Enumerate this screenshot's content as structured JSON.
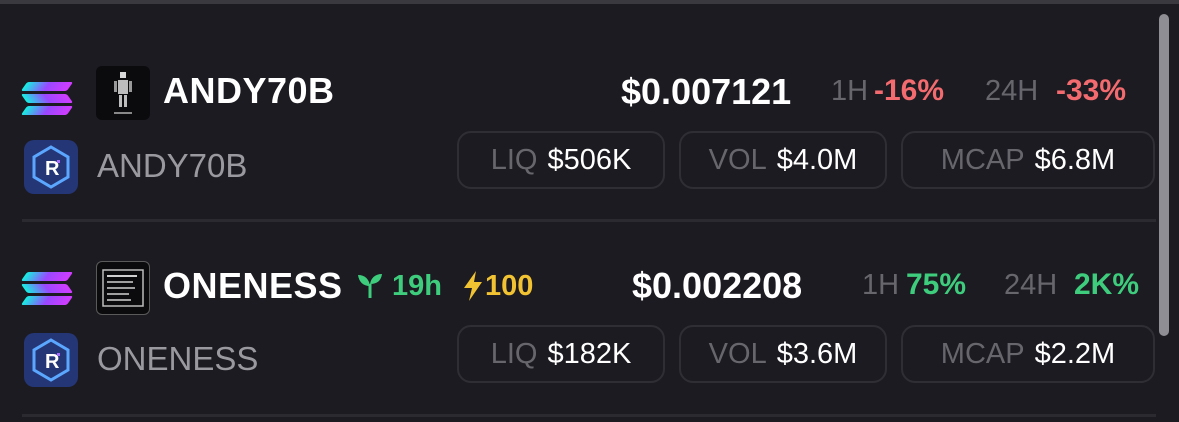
{
  "tokens": [
    {
      "chain_icon": "solana-icon",
      "avatar_icon": "pixel-figure-icon",
      "dex_icon": "raydium-icon",
      "name": "ANDY70B",
      "sub_name": "ANDY70B",
      "price": "$0.007121",
      "h1_label": "1H",
      "h1_change": "-16%",
      "h24_label": "24H",
      "h24_change": "-33%",
      "change_color": "#f36b6f",
      "liq_label": "LIQ",
      "liq_value": "$506K",
      "vol_label": "VOL",
      "vol_value": "$4.0M",
      "mcap_label": "MCAP",
      "mcap_value": "$6.8M"
    },
    {
      "chain_icon": "solana-icon",
      "avatar_icon": "terminal-icon",
      "dex_icon": "raydium-icon",
      "name": "ONENESS",
      "sub_name": "ONENESS",
      "age_icon": "sprout-icon",
      "age": "19h",
      "boost_icon": "lightning-icon",
      "boost": "100",
      "price": "$0.002208",
      "h1_label": "1H",
      "h1_change": "75%",
      "h24_label": "24H",
      "h24_change": "2K%",
      "change_color": "#3ecc7d",
      "liq_label": "LIQ",
      "liq_value": "$182K",
      "vol_label": "VOL",
      "vol_value": "$3.6M",
      "mcap_label": "MCAP",
      "mcap_value": "$2.2M"
    }
  ],
  "colors": {
    "background": "#1c1b21",
    "negative": "#f36b6f",
    "positive": "#3ecc7d",
    "boost": "#f1c332",
    "muted": "#67666d"
  }
}
